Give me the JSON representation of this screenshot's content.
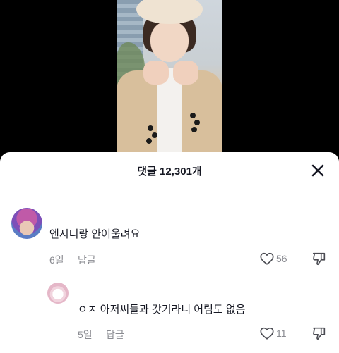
{
  "header": {
    "comments_label": "댓글 12,301개"
  },
  "comments": [
    {
      "text": "엔시티랑 안어울려요",
      "date": "6일",
      "reply_label": "답글",
      "likes": "56"
    },
    {
      "text": "ㅇㅈ 아저씨들과 갓기라니 어림도 없음",
      "date": "5일",
      "reply_label": "답글",
      "likes": "11"
    }
  ],
  "icons": {
    "close": "close-icon",
    "like": "heart-icon",
    "dislike": "thumbs-down-icon"
  },
  "colors": {
    "sheet_bg": "#ffffff",
    "text": "#161823",
    "meta": "#8a8b91",
    "backdrop": "#000000"
  }
}
